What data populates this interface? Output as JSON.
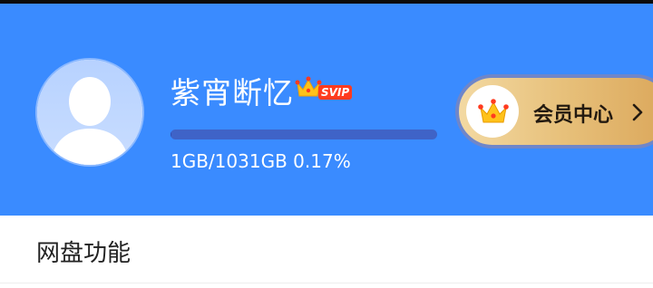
{
  "profile": {
    "username": "紫宵断忆",
    "badge_icon": "crown-icon",
    "badge_label": "SVIP",
    "avatar_icon": "default-user-avatar-icon"
  },
  "storage": {
    "text": "1GB/1031GB 0.17%",
    "used_fraction": 0.0017
  },
  "vip_center": {
    "icon": "crown-icon",
    "label": "会员中心",
    "chevron_icon": "chevron-right-icon"
  },
  "section": {
    "title": "网盘功能"
  },
  "colors": {
    "header_bg": "#3a8bff",
    "svip_badge": "#ff3b1f",
    "vip_gold": "#e7c07a",
    "progress_track": "#3f63c7"
  }
}
